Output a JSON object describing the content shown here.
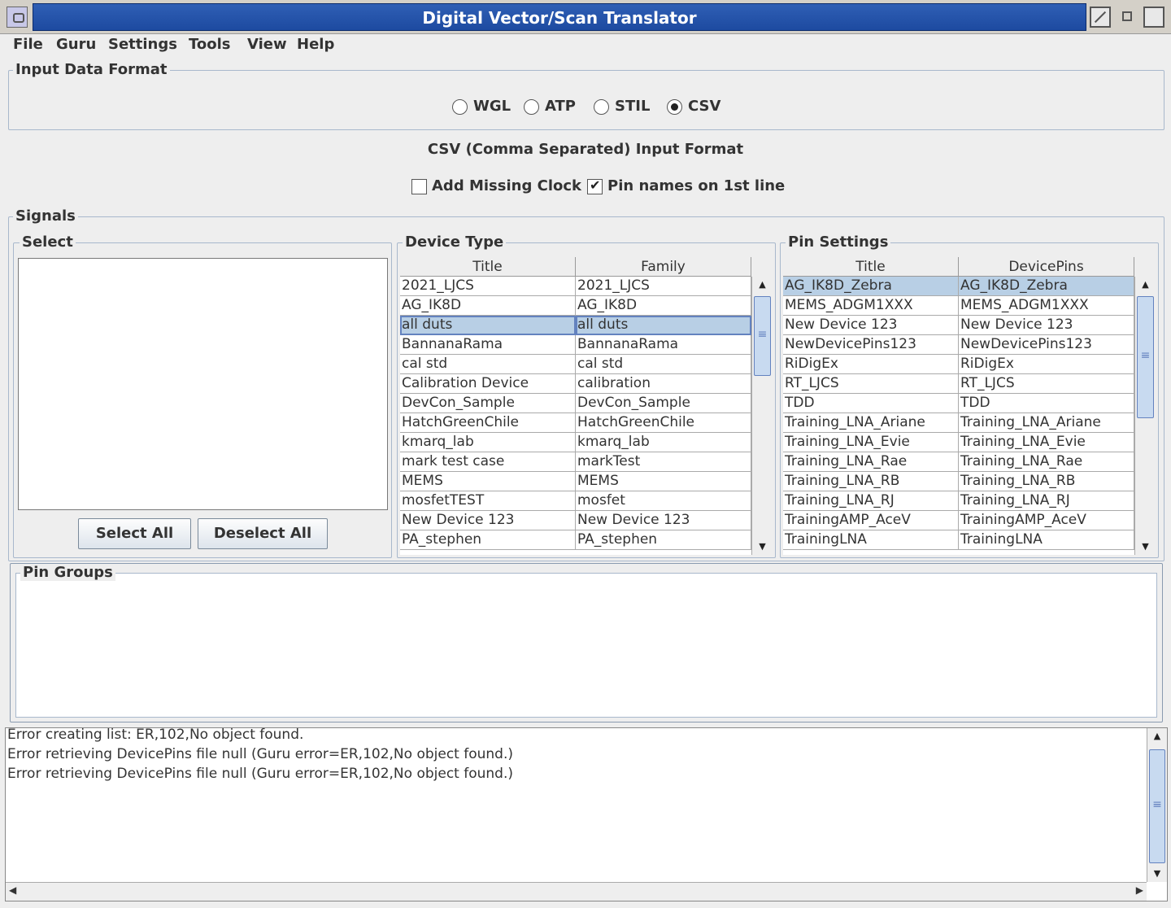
{
  "window": {
    "title": "Digital Vector/Scan Translator"
  },
  "menu": [
    "File",
    "Guru",
    "Settings",
    "Tools",
    "View",
    "Help"
  ],
  "input_format": {
    "group_title": "Input Data Format",
    "options": [
      "WGL",
      "ATP",
      "STIL",
      "CSV"
    ],
    "selected": "CSV",
    "format_caption": "CSV (Comma Separated) Input Format",
    "add_missing_clock": {
      "label": "Add Missing Clock",
      "checked": false
    },
    "pin_names_first_line": {
      "label": "Pin names on 1st line",
      "checked": true
    }
  },
  "signals": {
    "group_title": "Signals",
    "select": {
      "title": "Select",
      "select_all": "Select All",
      "deselect_all": "Deselect All"
    },
    "device_type": {
      "title": "Device Type",
      "columns": [
        "Title",
        "Family"
      ],
      "rows": [
        [
          "2021_LJCS",
          "2021_LJCS"
        ],
        [
          "AG_IK8D",
          "AG_IK8D"
        ],
        [
          "all duts",
          "all duts"
        ],
        [
          "BannanaRama",
          "BannanaRama"
        ],
        [
          "cal std",
          "cal std"
        ],
        [
          "Calibration Device",
          "calibration"
        ],
        [
          "DevCon_Sample",
          "DevCon_Sample"
        ],
        [
          "HatchGreenChile",
          "HatchGreenChile"
        ],
        [
          "kmarq_lab",
          "kmarq_lab"
        ],
        [
          "mark test case",
          "markTest"
        ],
        [
          "MEMS",
          "MEMS"
        ],
        [
          "mosfetTEST",
          "mosfet"
        ],
        [
          "New Device 123",
          "New Device 123"
        ],
        [
          "PA_stephen",
          "PA_stephen"
        ]
      ],
      "selected_row": 2
    },
    "pin_settings": {
      "title": "Pin Settings",
      "columns": [
        "Title",
        "DevicePins"
      ],
      "rows": [
        [
          "AG_IK8D_Zebra",
          "AG_IK8D_Zebra"
        ],
        [
          "MEMS_ADGM1XXX",
          "MEMS_ADGM1XXX"
        ],
        [
          "New Device 123",
          "New Device 123"
        ],
        [
          "NewDevicePins123",
          "NewDevicePins123"
        ],
        [
          "RiDigEx",
          "RiDigEx"
        ],
        [
          "RT_LJCS",
          "RT_LJCS"
        ],
        [
          "TDD",
          "TDD"
        ],
        [
          "Training_LNA_Ariane",
          "Training_LNA_Ariane"
        ],
        [
          "Training_LNA_Evie",
          "Training_LNA_Evie"
        ],
        [
          "Training_LNA_Rae",
          "Training_LNA_Rae"
        ],
        [
          "Training_LNA_RB",
          "Training_LNA_RB"
        ],
        [
          "Training_LNA_RJ",
          "Training_LNA_RJ"
        ],
        [
          "TrainingAMP_AceV",
          "TrainingAMP_AceV"
        ],
        [
          "TrainingLNA",
          "TrainingLNA"
        ]
      ],
      "selected_row": 0
    }
  },
  "pin_groups": {
    "title": "Pin Groups"
  },
  "log": [
    "Error creating list: ER,102,No object found.",
    "Error retrieving DevicePins file null (Guru error=ER,102,No object found.)",
    "Error retrieving DevicePins file null (Guru error=ER,102,No object found.)"
  ],
  "icons": {
    "up": "up-arrow-icon",
    "down": "down-arrow-icon",
    "left": "left-arrow-icon",
    "right": "right-arrow-icon"
  },
  "colors": {
    "titlebar": "#1d4aa0",
    "selection": "#b8cfe5",
    "accent": "#6382bf"
  }
}
